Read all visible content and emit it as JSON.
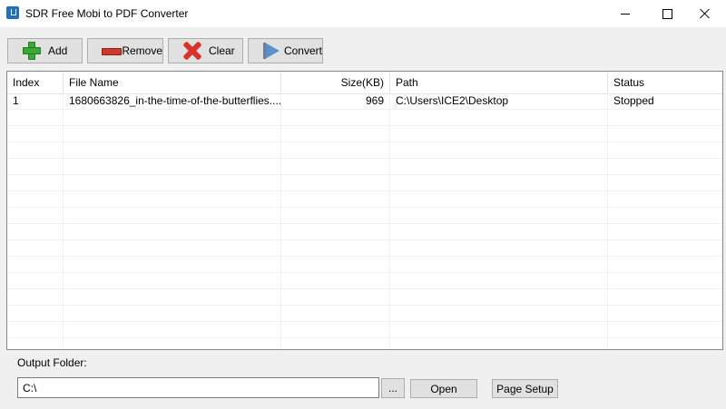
{
  "window": {
    "title": "SDR Free Mobi to PDF Converter",
    "icon": "app-download-icon",
    "controls": [
      "minimize",
      "maximize",
      "close"
    ]
  },
  "toolbar": {
    "add_label": "Add",
    "remove_label": "Remove",
    "clear_label": "Clear",
    "convert_label": "Convert"
  },
  "table": {
    "columns": [
      "Index",
      "File Name",
      "Size(KB)",
      "Path",
      "Status"
    ],
    "rows": [
      {
        "index": "1",
        "file_name": "1680663826_in-the-time-of-the-butterflies....",
        "size": "969",
        "path": "C:\\Users\\ICE2\\Desktop",
        "status": "Stopped"
      }
    ]
  },
  "output": {
    "label": "Output Folder:",
    "value": "C:\\",
    "browse_label": "...",
    "open_label": "Open",
    "page_setup_label": "Page Setup"
  },
  "colors": {
    "add_icon": "#3aa935",
    "remove_icon": "#d03a2b",
    "clear_icon": "#d8342c",
    "convert_icon": "#5a8fd0",
    "app_icon": "#1f6fc5"
  }
}
